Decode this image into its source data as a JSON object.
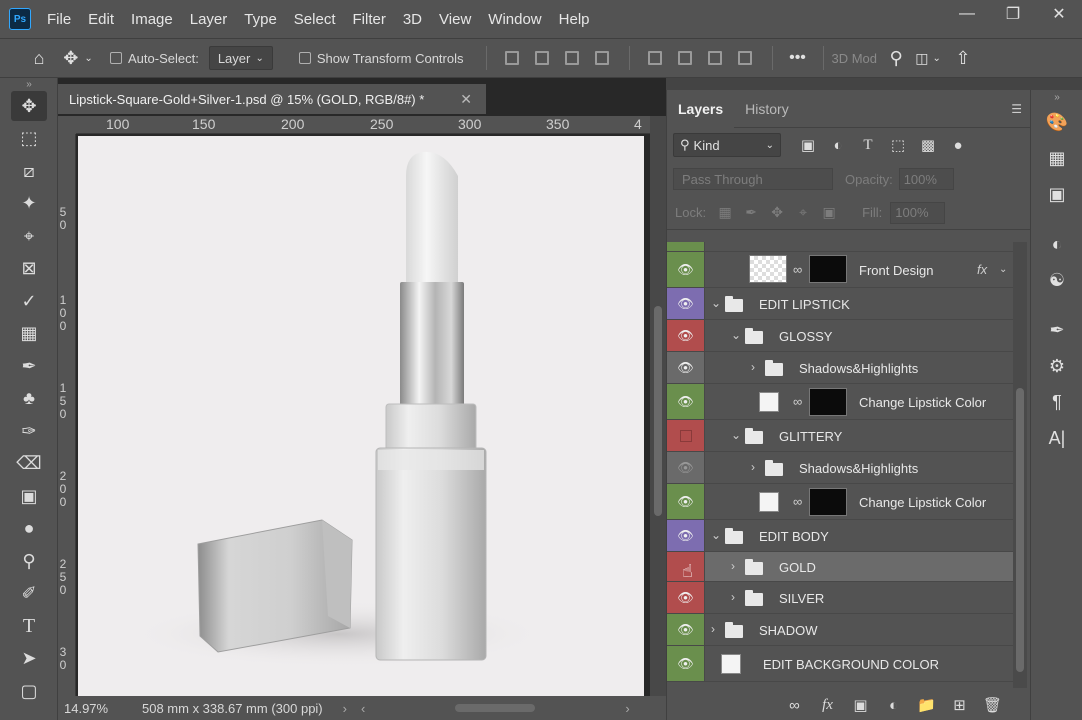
{
  "app": {
    "logo": "Ps",
    "menu": [
      "File",
      "Edit",
      "Image",
      "Layer",
      "Type",
      "Select",
      "Filter",
      "3D",
      "View",
      "Window",
      "Help"
    ],
    "window_controls": [
      "minimize",
      "restore",
      "close"
    ]
  },
  "options_bar": {
    "auto_select_label": "Auto-Select:",
    "auto_select_target": "Layer",
    "show_transform_label": "Show Transform Controls",
    "mode_3d_label": "3D Mod"
  },
  "document": {
    "tab_title": "Lipstick-Square-Gold+Silver-1.psd @ 15% (GOLD, RGB/8#) *",
    "ruler_h": [
      "100",
      "150",
      "200",
      "250",
      "300",
      "350",
      "4"
    ],
    "ruler_v": [
      "5 0",
      "1 0 0",
      "1 5 0",
      "2 0 0",
      "2 5 0",
      "3 0"
    ],
    "zoom": "14.97%",
    "doc_size": "508 mm x 338.67 mm (300 ppi)"
  },
  "panel": {
    "tabs": [
      "Layers",
      "History"
    ],
    "kind_label": "Kind",
    "blend_mode": "Pass Through",
    "opacity_label": "Opacity:",
    "opacity_value": "100%",
    "lock_label": "Lock:",
    "fill_label": "Fill:",
    "fill_value": "100%",
    "layers": [
      {
        "name": "Front Design",
        "type": "smart",
        "color": "#6a8f4d",
        "visible": true,
        "indent": 0,
        "fx": "fx"
      },
      {
        "name": "EDIT LIPSTICK",
        "type": "group",
        "color": "#7d6db0",
        "visible": true,
        "indent": 0,
        "expanded": true
      },
      {
        "name": "GLOSSY",
        "type": "group",
        "color": "#b14d4d",
        "visible": true,
        "indent": 1,
        "expanded": true
      },
      {
        "name": "Shadows&Highlights",
        "type": "group",
        "color": "#6a6a6a",
        "visible": true,
        "indent": 2,
        "expanded": false
      },
      {
        "name": "Change Lipstick Color",
        "type": "fill",
        "color": "#6a8f4d",
        "visible": true,
        "indent": 2
      },
      {
        "name": "GLITTERY",
        "type": "group",
        "color": "#b14d4d",
        "visible": false,
        "indent": 1,
        "expanded": true
      },
      {
        "name": "Shadows&Highlights",
        "type": "group",
        "color": "#6a6a6a",
        "visible": true,
        "indent": 2,
        "expanded": false
      },
      {
        "name": "Change Lipstick Color",
        "type": "fill",
        "color": "#6a8f4d",
        "visible": true,
        "indent": 2
      },
      {
        "name": "EDIT BODY",
        "type": "group",
        "color": "#7d6db0",
        "visible": true,
        "indent": 0,
        "expanded": true
      },
      {
        "name": "GOLD",
        "type": "group",
        "color": "#b14d4d",
        "visible": false,
        "indent": 1,
        "expanded": false,
        "selected": true
      },
      {
        "name": "SILVER",
        "type": "group",
        "color": "#b14d4d",
        "visible": true,
        "indent": 1,
        "expanded": false
      },
      {
        "name": "SHADOW",
        "type": "group",
        "color": "#6a8f4d",
        "visible": true,
        "indent": 0,
        "expanded": false
      },
      {
        "name": "EDIT BACKGROUND COLOR",
        "type": "fill-white",
        "color": "#6a8f4d",
        "visible": true,
        "indent": 0
      }
    ]
  }
}
